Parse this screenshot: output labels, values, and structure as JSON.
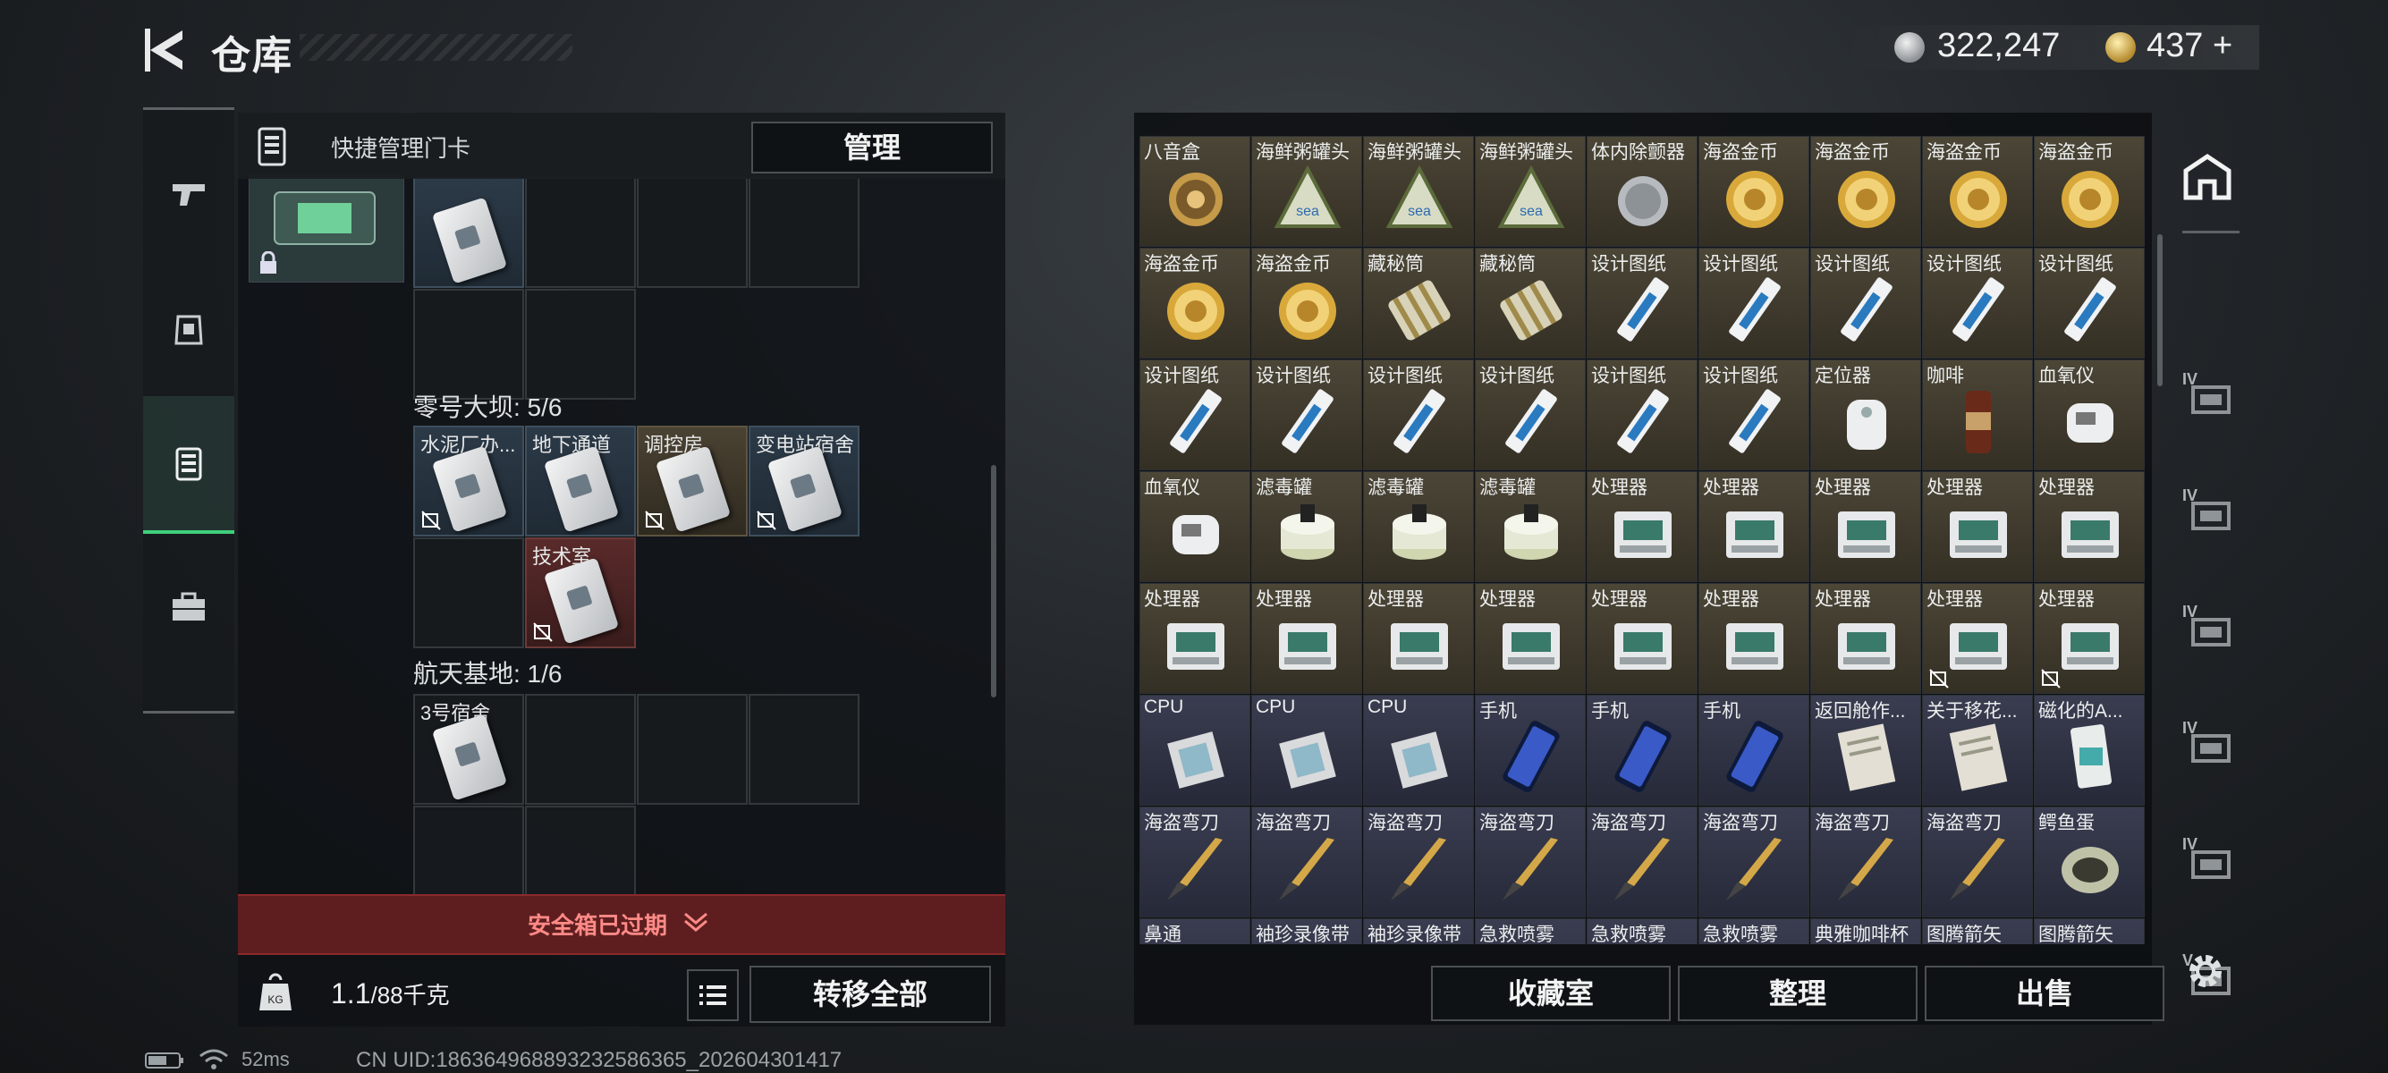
{
  "header": {
    "title": "仓库",
    "silver": "322,247",
    "gold": "437",
    "gold_plus": "+"
  },
  "card_panel": {
    "title": "快捷管理门卡",
    "manage_label": "管理",
    "sections": [
      {
        "title": "",
        "slots": [
          {
            "label": "",
            "rarity": "blue",
            "card": true,
            "nosell": false,
            "col": 0,
            "row": 0
          },
          {
            "label": "",
            "rarity": "none",
            "card": false,
            "nosell": false,
            "col": 1,
            "row": 0
          },
          {
            "label": "",
            "rarity": "none",
            "card": false,
            "nosell": false,
            "col": 2,
            "row": 0
          },
          {
            "label": "",
            "rarity": "none",
            "card": false,
            "nosell": false,
            "col": 3,
            "row": 0
          },
          {
            "label": "",
            "rarity": "none",
            "card": false,
            "nosell": false,
            "col": 0,
            "row": 1
          },
          {
            "label": "",
            "rarity": "none",
            "card": false,
            "nosell": false,
            "col": 1,
            "row": 1
          }
        ]
      },
      {
        "title": "零号大坝: 5/6",
        "slots": [
          {
            "label": "水泥厂办...",
            "rarity": "blue",
            "card": true,
            "nosell": true,
            "col": 0,
            "row": 0
          },
          {
            "label": "地下通道",
            "rarity": "blue",
            "card": true,
            "nosell": false,
            "col": 1,
            "row": 0
          },
          {
            "label": "调控房",
            "rarity": "gold",
            "card": true,
            "nosell": true,
            "col": 2,
            "row": 0
          },
          {
            "label": "变电站宿舍",
            "rarity": "blue",
            "card": true,
            "nosell": true,
            "col": 3,
            "row": 0
          },
          {
            "label": "",
            "rarity": "none",
            "card": false,
            "nosell": false,
            "col": 0,
            "row": 1
          },
          {
            "label": "技术室",
            "rarity": "red",
            "card": true,
            "nosell": true,
            "col": 1,
            "row": 1
          }
        ]
      },
      {
        "title": "航天基地: 1/6",
        "slots": [
          {
            "label": "3号宿舍",
            "rarity": "purple",
            "card": true,
            "nosell": false,
            "col": 0,
            "row": 0
          },
          {
            "label": "",
            "rarity": "none",
            "card": false,
            "nosell": false,
            "col": 1,
            "row": 0
          },
          {
            "label": "",
            "rarity": "none",
            "card": false,
            "nosell": false,
            "col": 2,
            "row": 0
          },
          {
            "label": "",
            "rarity": "none",
            "card": false,
            "nosell": false,
            "col": 3,
            "row": 0
          },
          {
            "label": "",
            "rarity": "none",
            "card": false,
            "nosell": false,
            "col": 0,
            "row": 1
          },
          {
            "label": "",
            "rarity": "none",
            "card": false,
            "nosell": false,
            "col": 1,
            "row": 1
          }
        ]
      }
    ],
    "expired_text": "安全箱已过期",
    "weight_value": "1.1",
    "weight_max": "/88千克",
    "transfer_label": "转移全部"
  },
  "status_bar": {
    "ping": "52ms",
    "uid": "CN UID:186364968893232586365_202604301417"
  },
  "stash": {
    "rows": [
      [
        {
          "label": "八音盒",
          "art": "music-box",
          "rarity": "gold"
        },
        {
          "label": "海鲜粥罐头",
          "art": "can",
          "rarity": "gold"
        },
        {
          "label": "海鲜粥罐头",
          "art": "can",
          "rarity": "gold"
        },
        {
          "label": "海鲜粥罐头",
          "art": "can",
          "rarity": "gold"
        },
        {
          "label": "体内除颤器",
          "art": "defib",
          "rarity": "gold"
        },
        {
          "label": "海盗金币",
          "art": "coin",
          "rarity": "gold"
        },
        {
          "label": "海盗金币",
          "art": "coin",
          "rarity": "gold"
        },
        {
          "label": "海盗金币",
          "art": "coin",
          "rarity": "gold"
        },
        {
          "label": "海盗金币",
          "art": "coin",
          "rarity": "gold"
        }
      ],
      [
        {
          "label": "海盗金币",
          "art": "coin",
          "rarity": "gold"
        },
        {
          "label": "海盗金币",
          "art": "coin",
          "rarity": "gold"
        },
        {
          "label": "藏秘筒",
          "art": "cryptex",
          "rarity": "gold"
        },
        {
          "label": "藏秘筒",
          "art": "cryptex",
          "rarity": "gold"
        },
        {
          "label": "设计图纸",
          "art": "blueprint",
          "rarity": "gold"
        },
        {
          "label": "设计图纸",
          "art": "blueprint",
          "rarity": "gold"
        },
        {
          "label": "设计图纸",
          "art": "blueprint",
          "rarity": "gold"
        },
        {
          "label": "设计图纸",
          "art": "blueprint",
          "rarity": "gold"
        },
        {
          "label": "设计图纸",
          "art": "blueprint",
          "rarity": "gold"
        }
      ],
      [
        {
          "label": "设计图纸",
          "art": "blueprint",
          "rarity": "gold"
        },
        {
          "label": "设计图纸",
          "art": "blueprint",
          "rarity": "gold"
        },
        {
          "label": "设计图纸",
          "art": "blueprint",
          "rarity": "gold"
        },
        {
          "label": "设计图纸",
          "art": "blueprint",
          "rarity": "gold"
        },
        {
          "label": "设计图纸",
          "art": "blueprint",
          "rarity": "gold"
        },
        {
          "label": "设计图纸",
          "art": "blueprint",
          "rarity": "gold"
        },
        {
          "label": "定位器",
          "art": "locator",
          "rarity": "gold"
        },
        {
          "label": "咖啡",
          "art": "coffee",
          "rarity": "gold"
        },
        {
          "label": "血氧仪",
          "art": "oximeter",
          "rarity": "gold"
        }
      ],
      [
        {
          "label": "血氧仪",
          "art": "oximeter",
          "rarity": "gold"
        },
        {
          "label": "滤毒罐",
          "art": "filter",
          "rarity": "gold"
        },
        {
          "label": "滤毒罐",
          "art": "filter",
          "rarity": "gold"
        },
        {
          "label": "滤毒罐",
          "art": "filter",
          "rarity": "gold"
        },
        {
          "label": "处理器",
          "art": "processor",
          "rarity": "gold"
        },
        {
          "label": "处理器",
          "art": "processor",
          "rarity": "gold"
        },
        {
          "label": "处理器",
          "art": "processor",
          "rarity": "gold"
        },
        {
          "label": "处理器",
          "art": "processor",
          "rarity": "gold"
        },
        {
          "label": "处理器",
          "art": "processor",
          "rarity": "gold"
        }
      ],
      [
        {
          "label": "处理器",
          "art": "processor",
          "rarity": "gold"
        },
        {
          "label": "处理器",
          "art": "processor",
          "rarity": "gold"
        },
        {
          "label": "处理器",
          "art": "processor",
          "rarity": "gold"
        },
        {
          "label": "处理器",
          "art": "processor",
          "rarity": "gold"
        },
        {
          "label": "处理器",
          "art": "processor",
          "rarity": "gold"
        },
        {
          "label": "处理器",
          "art": "processor",
          "rarity": "gold"
        },
        {
          "label": "处理器",
          "art": "processor",
          "rarity": "gold"
        },
        {
          "label": "处理器",
          "art": "processor",
          "rarity": "gold",
          "nosell": true
        },
        {
          "label": "处理器",
          "art": "processor",
          "rarity": "gold",
          "nosell": true
        }
      ],
      [
        {
          "label": "CPU",
          "art": "cpu",
          "rarity": "purple"
        },
        {
          "label": "CPU",
          "art": "cpu",
          "rarity": "purple"
        },
        {
          "label": "CPU",
          "art": "cpu",
          "rarity": "purple"
        },
        {
          "label": "手机",
          "art": "phone",
          "rarity": "purple"
        },
        {
          "label": "手机",
          "art": "phone",
          "rarity": "purple"
        },
        {
          "label": "手机",
          "art": "phone",
          "rarity": "purple"
        },
        {
          "label": "返回舱作...",
          "art": "document",
          "rarity": "purple"
        },
        {
          "label": "关于移花...",
          "art": "document",
          "rarity": "purple"
        },
        {
          "label": "磁化的A...",
          "art": "card",
          "rarity": "purple"
        }
      ],
      [
        {
          "label": "海盗弯刀",
          "art": "knife",
          "rarity": "purple"
        },
        {
          "label": "海盗弯刀",
          "art": "knife",
          "rarity": "purple"
        },
        {
          "label": "海盗弯刀",
          "art": "knife",
          "rarity": "purple"
        },
        {
          "label": "海盗弯刀",
          "art": "knife",
          "rarity": "purple"
        },
        {
          "label": "海盗弯刀",
          "art": "knife",
          "rarity": "purple"
        },
        {
          "label": "海盗弯刀",
          "art": "knife",
          "rarity": "purple"
        },
        {
          "label": "海盗弯刀",
          "art": "knife",
          "rarity": "purple"
        },
        {
          "label": "海盗弯刀",
          "art": "knife",
          "rarity": "purple"
        },
        {
          "label": "鳄鱼蛋",
          "art": "egg",
          "rarity": "purple"
        }
      ],
      [
        {
          "label": "鼻通",
          "art": "spray",
          "rarity": "purple"
        },
        {
          "label": "袖珍录像带",
          "art": "tape",
          "rarity": "purple"
        },
        {
          "label": "袖珍录像带",
          "art": "tape",
          "rarity": "purple"
        },
        {
          "label": "急救喷雾",
          "art": "spray",
          "rarity": "purple"
        },
        {
          "label": "急救喷雾",
          "art": "spray",
          "rarity": "purple"
        },
        {
          "label": "急救喷雾",
          "art": "spray",
          "rarity": "purple"
        },
        {
          "label": "典雅咖啡杯",
          "art": "cup",
          "rarity": "purple"
        },
        {
          "label": "图腾箭矢",
          "art": "arrow",
          "rarity": "purple"
        },
        {
          "label": "图腾箭矢",
          "art": "arrow",
          "rarity": "purple"
        }
      ]
    ],
    "buttons": {
      "collection": "收藏室",
      "sort": "整理",
      "sell": "出售"
    }
  },
  "tools": [
    {
      "name": "tool-home",
      "tier": ""
    },
    {
      "name": "tool-folder",
      "tier": "IV"
    },
    {
      "name": "tool-weapon",
      "tier": "IV"
    },
    {
      "name": "tool-medical",
      "tier": "IV"
    },
    {
      "name": "tool-armor",
      "tier": "IV"
    },
    {
      "name": "tool-medkit",
      "tier": "IV"
    },
    {
      "name": "tool-view",
      "tier": "V"
    }
  ],
  "colors": {
    "accent_green": "#3fd07c",
    "expired_red": "#5e1e20",
    "gold_tier": "#4c4637",
    "purple_tier": "#3a3d50"
  }
}
